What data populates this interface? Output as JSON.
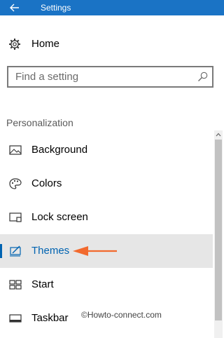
{
  "window": {
    "title": "Settings"
  },
  "home": {
    "label": "Home",
    "icon": "gear-icon"
  },
  "search": {
    "placeholder": "Find a setting",
    "value": "",
    "icon": "search-icon"
  },
  "section": {
    "title": "Personalization"
  },
  "nav": {
    "items": [
      {
        "label": "Background",
        "icon": "picture-icon",
        "selected": false
      },
      {
        "label": "Colors",
        "icon": "palette-icon",
        "selected": false
      },
      {
        "label": "Lock screen",
        "icon": "lock-screen-icon",
        "selected": false
      },
      {
        "label": "Themes",
        "icon": "themes-brush-icon",
        "selected": true
      },
      {
        "label": "Start",
        "icon": "start-tiles-icon",
        "selected": false
      },
      {
        "label": "Taskbar",
        "icon": "taskbar-icon",
        "selected": false
      }
    ]
  },
  "watermark": "©Howto-connect.com",
  "colors": {
    "titlebar": "#1a73c5",
    "accent": "#0063b1",
    "annotation_arrow": "#f26a2e"
  }
}
